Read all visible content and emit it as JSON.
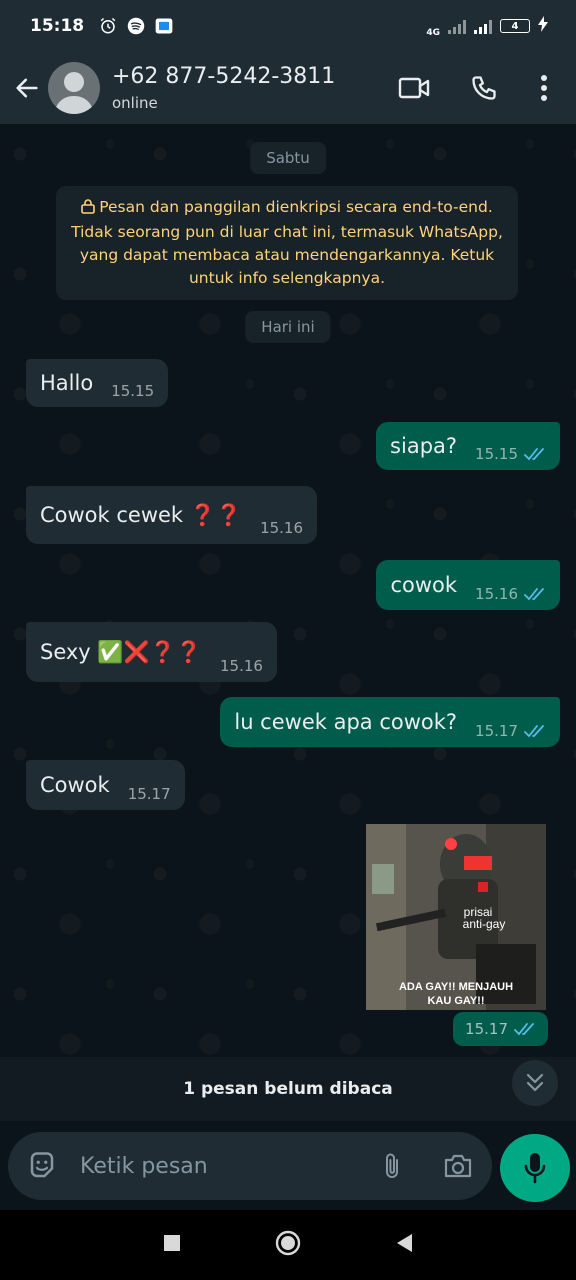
{
  "status_bar": {
    "time": "15:18",
    "network": "4G",
    "battery": "4"
  },
  "header": {
    "contact_name": "+62 877-5242-3811",
    "contact_status": "online",
    "icons": [
      "back-arrow-icon",
      "video-call-icon",
      "voice-call-icon",
      "more-vert-icon"
    ]
  },
  "chat": {
    "date_saturday": "Sabtu",
    "encryption_notice": "Pesan dan panggilan dienkripsi secara end-to-end. Tidak seorang pun di luar chat ini, termasuk WhatsApp, yang dapat membaca atau mendengarkannya. Ketuk untuk info selengkapnya.",
    "date_today": "Hari ini",
    "messages": [
      {
        "direction": "in",
        "text": "Hallo",
        "time": "15.15"
      },
      {
        "direction": "out",
        "text": "siapa?",
        "time": "15.15",
        "read": true
      },
      {
        "direction": "in",
        "text": "Cowok cewek ❓❓",
        "time": "15.16"
      },
      {
        "direction": "out",
        "text": "cowok",
        "time": "15.16",
        "read": true
      },
      {
        "direction": "in",
        "text": "Sexy ✅❌❓❓",
        "time": "15.16"
      },
      {
        "direction": "out",
        "text": "lu cewek apa cowok?",
        "time": "15.17",
        "read": true
      },
      {
        "direction": "in",
        "text": "Cowok",
        "time": "15.17"
      }
    ],
    "image_message": {
      "caption_top": "prisai anti-gay",
      "caption_bottom": "ADA GAY!! MENJAUH KAU GAY!!",
      "time": "15.17",
      "read": true
    },
    "unread_banner": "1 pesan belum dibaca"
  },
  "composer": {
    "placeholder": "Ketik pesan"
  },
  "colors": {
    "header_bg": "#1f2c34",
    "chat_bg": "#0b141a",
    "incoming_bubble": "#202c33",
    "outgoing_bubble": "#005c4b",
    "accent": "#00a884",
    "read_ticks": "#53bdeb"
  }
}
